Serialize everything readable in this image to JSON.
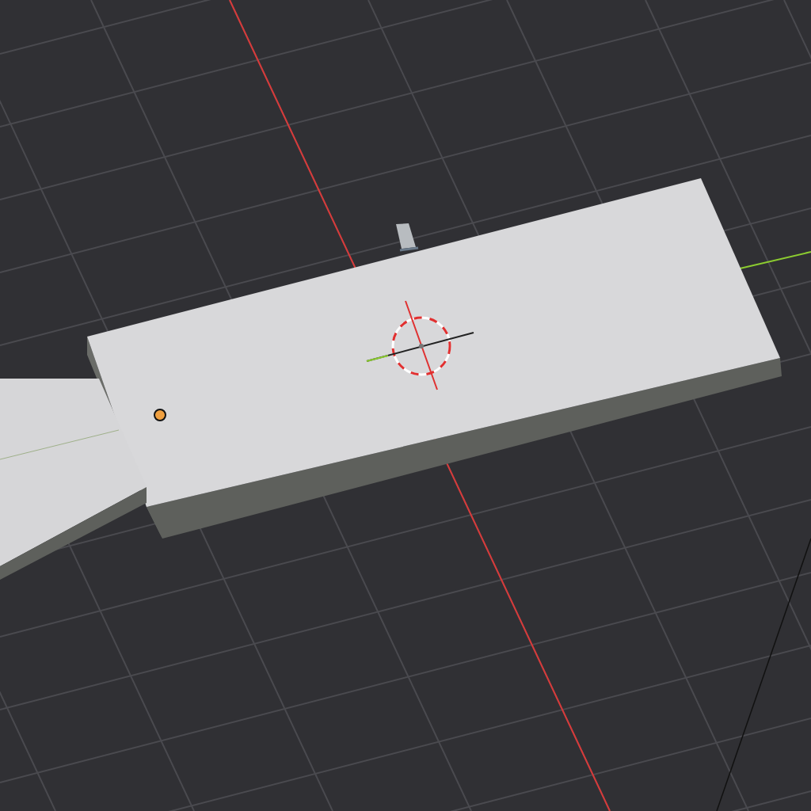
{
  "viewport": {
    "objects": [
      {
        "kind": "slab"
      },
      {
        "kind": "wedge"
      },
      {
        "kind": "stub"
      }
    ],
    "origin_selected": true
  }
}
